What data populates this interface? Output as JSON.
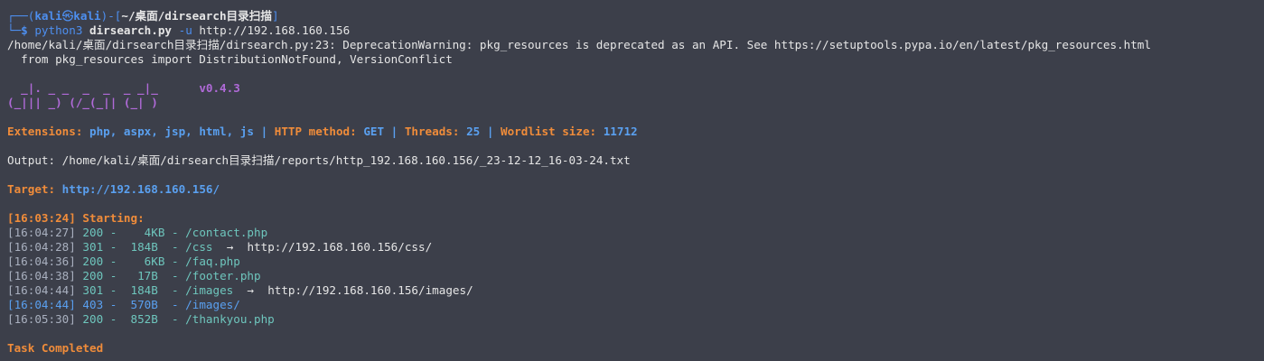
{
  "prompt": {
    "corner_top": "┌──(",
    "user": "kali",
    "at_icon": "㉿",
    "host": "kali",
    "mid": ")-[",
    "path": "~/桌面/dirsearch目录扫描",
    "close": "]",
    "corner_bottom": "└─",
    "dollar": "$ ",
    "cmd_bin": "python3",
    "cmd_script": "dirsearch.py",
    "cmd_flag": "-u",
    "cmd_url": "http://192.168.160.156"
  },
  "warning": {
    "line1": "/home/kali/桌面/dirsearch目录扫描/dirsearch.py:23: DeprecationWarning: pkg_resources is deprecated as an API. See https://setuptools.pypa.io/en/latest/pkg_resources.html",
    "line2": "  from pkg_resources import DistributionNotFound, VersionConflict"
  },
  "banner": {
    "row1": "  _|. _ _  _  _  _ _|_",
    "row2": "(_||| _) (/_(_|| (_| )",
    "version": "v0.4.3"
  },
  "config": {
    "extensions_label": "Extensions: ",
    "extensions_value": "php, aspx, jsp, html, js",
    "sep": " | ",
    "method_label": "HTTP method: ",
    "method_value": "GET",
    "threads_label": "Threads: ",
    "threads_value": "25",
    "wordlist_label": "Wordlist size: ",
    "wordlist_value": "11712"
  },
  "output": {
    "label": "Output: ",
    "path": "/home/kali/桌面/dirsearch目录扫描/reports/http_192.168.160.156/_23-12-12_16-03-24.txt"
  },
  "target": {
    "label": "Target: ",
    "url": "http://192.168.160.156/"
  },
  "start": {
    "time": "[16:03:24]",
    "text": " Starting:"
  },
  "results": [
    {
      "time": "[16:04:27]",
      "code": "200",
      "size": "   4KB",
      "path": "/contact.php",
      "redirect": ""
    },
    {
      "time": "[16:04:28]",
      "code": "301",
      "size": " 184B ",
      "path": "/css",
      "redirect": "http://192.168.160.156/css/"
    },
    {
      "time": "[16:04:36]",
      "code": "200",
      "size": "   6KB",
      "path": "/faq.php",
      "redirect": ""
    },
    {
      "time": "[16:04:38]",
      "code": "200",
      "size": "  17B ",
      "path": "/footer.php",
      "redirect": ""
    },
    {
      "time": "[16:04:44]",
      "code": "301",
      "size": " 184B ",
      "path": "/images",
      "redirect": "http://192.168.160.156/images/"
    },
    {
      "time": "[16:04:44]",
      "code": "403",
      "size": " 570B ",
      "path": "/images/",
      "redirect": ""
    },
    {
      "time": "[16:05:30]",
      "code": "200",
      "size": " 852B ",
      "path": "/thankyou.php",
      "redirect": ""
    }
  ],
  "arrow": "→",
  "dash": " - ",
  "done": "Task Completed"
}
